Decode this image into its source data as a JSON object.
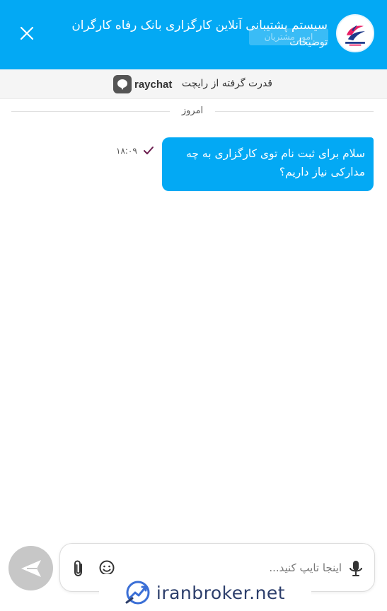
{
  "header": {
    "title": "سیستم پشتیبانی آنلاین کارگزاری بانک رفاه کارگران",
    "subtitle": "توضیحات",
    "background_text": "امور مشتریان",
    "accent_color": "#03a9f4",
    "avatar_icon": "refah-broker-logo",
    "close_icon": "close-icon"
  },
  "powered": {
    "text": "قدرت گرفته از رایچت",
    "brand": "raychat"
  },
  "chat": {
    "day_label": "امروز",
    "messages": [
      {
        "text": "سلام برای ثبت نام توی کارگزاری به چه مدارکی نیاز داریم؟",
        "time": "۱۸:۰۹",
        "status_icon": "check-icon",
        "status_color": "#6a1b4d"
      }
    ]
  },
  "composer": {
    "placeholder": "اینجا تایپ کنید...",
    "mic_icon": "microphone-icon",
    "emoji_icon": "emoji-icon",
    "attach_icon": "paperclip-icon",
    "send_icon": "send-icon"
  },
  "watermark": {
    "text": "iranbroker.net"
  }
}
